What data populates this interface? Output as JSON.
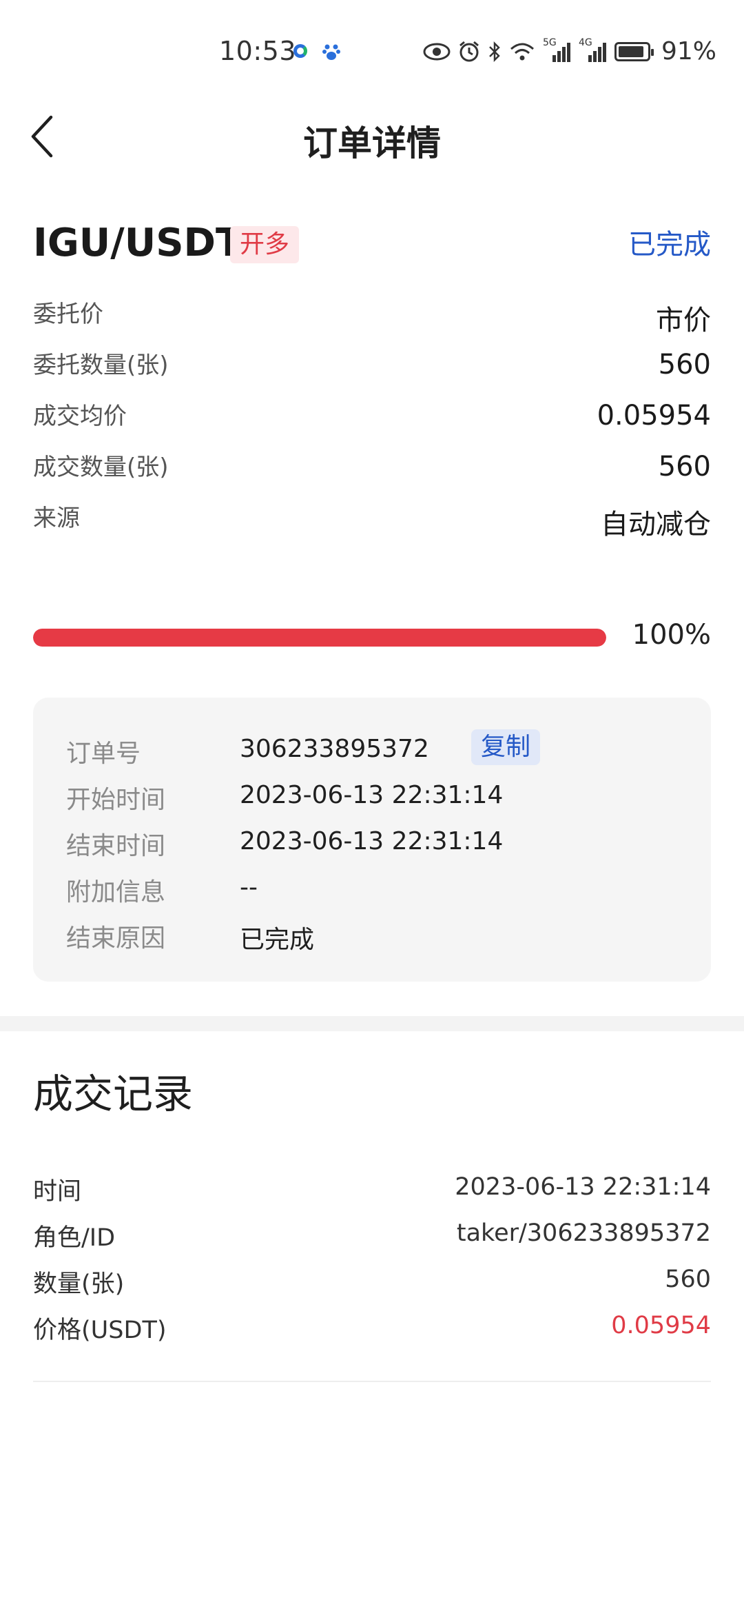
{
  "status_bar": {
    "time": "10:53",
    "battery": "91%",
    "signal_1": "5G",
    "signal_2": "4G",
    "battery_level_percent": 91
  },
  "header": {
    "title": "订单详情"
  },
  "order": {
    "pair": "IGU/USDT",
    "side_badge": "开多",
    "status": "已完成",
    "rows": [
      {
        "label": "委托价",
        "value": "市价"
      },
      {
        "label": "委托数量(张)",
        "value": "560"
      },
      {
        "label": "成交均价",
        "value": "0.05954"
      },
      {
        "label": "成交数量(张)",
        "value": "560"
      },
      {
        "label": "来源",
        "value": "自动减仓"
      }
    ],
    "progress_text": "100%",
    "progress_percent": 100
  },
  "info": {
    "order_no_label": "订单号",
    "order_no": "306233895372",
    "copy_label": "复制",
    "start_label": "开始时间",
    "start_time": "2023-06-13 22:31:14",
    "end_label": "结束时间",
    "end_time": "2023-06-13 22:31:14",
    "extra_label": "附加信息",
    "extra_value": "--",
    "reason_label": "结束原因",
    "reason_value": "已完成"
  },
  "trades": {
    "title": "成交记录",
    "rows": [
      {
        "label": "时间",
        "value": "2023-06-13 22:31:14"
      },
      {
        "label": "角色/ID",
        "value": "taker/306233895372"
      },
      {
        "label": "数量(张)",
        "value": "560"
      },
      {
        "label": "价格(USDT)",
        "value": "0.05954"
      }
    ]
  },
  "colors": {
    "accent_blue": "#2559c7",
    "accent_red": "#e63a45"
  }
}
